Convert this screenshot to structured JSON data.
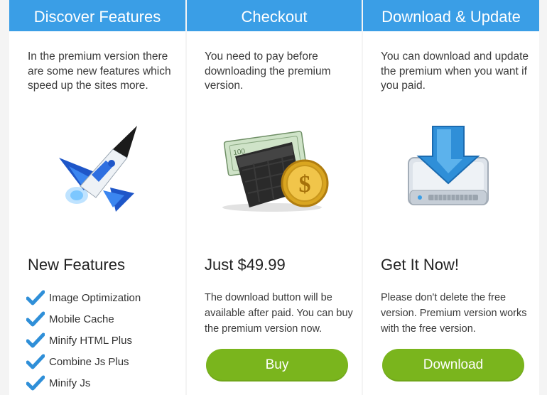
{
  "columns": [
    {
      "title": "Discover Features",
      "description": "In the premium version there are some new features which speed up the sites more.",
      "image_icon": "rocket-icon",
      "subtitle": "New Features",
      "features": [
        "Image Optimization",
        "Mobile Cache",
        "Minify HTML Plus",
        "Combine Js Plus",
        "Minify Js"
      ]
    },
    {
      "title": "Checkout",
      "description": "You need to pay before downloading the premium version.",
      "image_icon": "wallet-money-icon",
      "subtitle": "Just $49.99",
      "note": "The download button will be available after paid. You can buy the premium version now.",
      "button_label": "Buy"
    },
    {
      "title": "Download & Update",
      "description": "You can download and update the premium when you want if you paid.",
      "image_icon": "download-drive-icon",
      "subtitle": "Get It Now!",
      "note": "Please don't delete the free version. Premium version works with the free version.",
      "button_label": "Download"
    }
  ],
  "colors": {
    "header_bg": "#3a9ee6",
    "button_bg": "#7ab51d",
    "check": "#2f8fd8"
  }
}
